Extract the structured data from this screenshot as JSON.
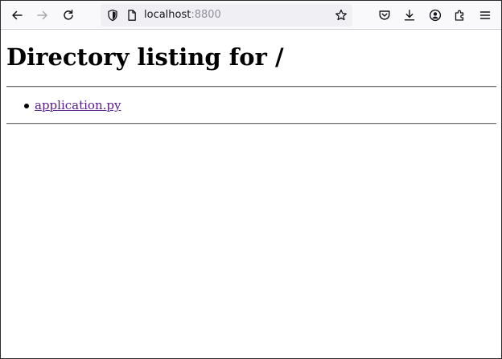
{
  "browser": {
    "url_host": "localhost",
    "url_port": ":8800",
    "icons": {
      "back": "arrow-left-icon",
      "forward": "arrow-right-icon",
      "reload": "reload-icon",
      "tracking": "shield-icon",
      "page": "page-icon",
      "bookmark": "star-icon",
      "pocket": "pocket-icon",
      "downloads": "download-icon",
      "account": "account-icon",
      "extensions": "puzzle-icon",
      "menu": "hamburger-menu-icon"
    },
    "forward_enabled": false
  },
  "page": {
    "title": "Directory listing for /",
    "files": [
      {
        "name": "application.py"
      }
    ]
  },
  "colors": {
    "visited_link": "#551a8b",
    "toolbar_bg": "#f9f9fb",
    "urlbar_bg": "#f0f0f4"
  }
}
